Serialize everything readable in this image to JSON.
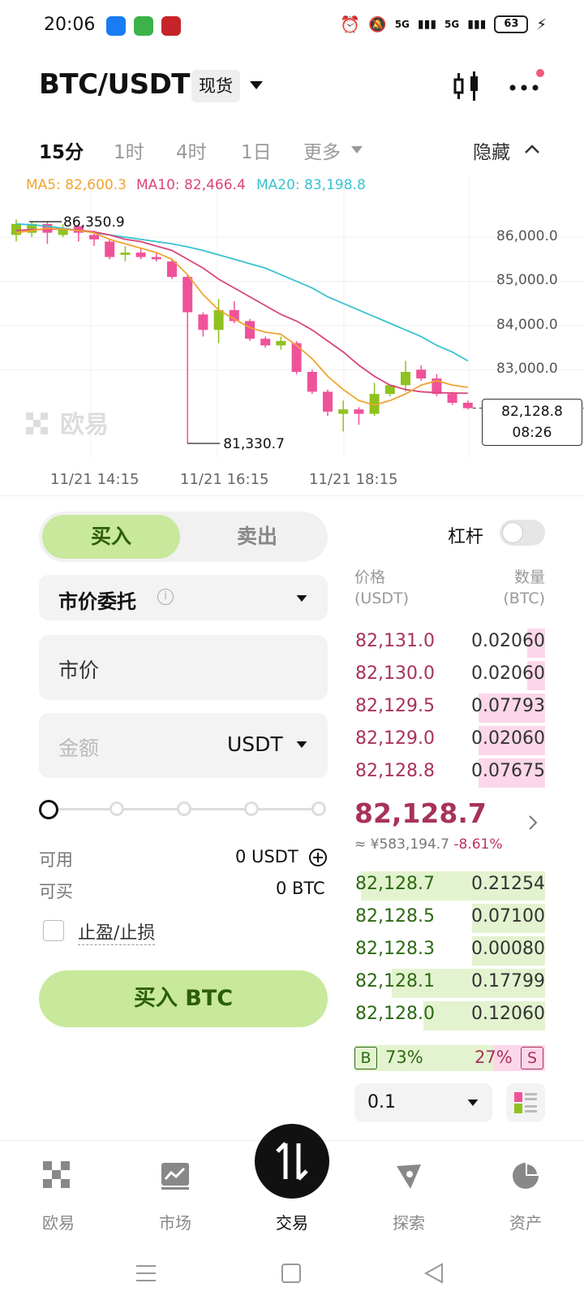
{
  "status_bar": {
    "time": "20:06",
    "battery": "63",
    "network": "5G"
  },
  "header": {
    "pair": "BTC/USDT",
    "market_tag": "现货"
  },
  "timeframes": {
    "items": [
      "15分",
      "1时",
      "4时",
      "1日",
      "更多"
    ],
    "active": "15分",
    "hide_label": "隐藏"
  },
  "chart": {
    "ma5_label": "MA5: 82,600.3",
    "ma10_label": "MA10: 82,466.4",
    "ma20_label": "MA20: 83,198.8",
    "colors": {
      "ma5": "#f0a430",
      "ma10": "#d9457a",
      "ma20": "#38c2d0",
      "up": "#8fc21e",
      "down": "#f0529a"
    },
    "watermark": "欧易",
    "high_label": "86,350.9",
    "low_label": "81,330.7",
    "last_price": "82,128.8",
    "countdown": "08:26",
    "y_ticks": [
      "86,000.0",
      "85,000.0",
      "84,000.0",
      "83,000.0"
    ],
    "x_ticks": [
      "11/21 14:15",
      "11/21 16:15",
      "11/21 18:15"
    ]
  },
  "chart_data": {
    "type": "candlestick",
    "ylim": [
      81000,
      86700
    ],
    "candles": [
      {
        "o": 86050,
        "h": 86400,
        "c": 86300,
        "l": 85900
      },
      {
        "o": 86100,
        "h": 86350,
        "c": 86300,
        "l": 86000
      },
      {
        "o": 86300,
        "h": 86350,
        "c": 86100,
        "l": 85850
      },
      {
        "o": 86050,
        "h": 86300,
        "c": 86200,
        "l": 86000
      },
      {
        "o": 86250,
        "h": 86300,
        "c": 86100,
        "l": 85900
      },
      {
        "o": 86050,
        "h": 86150,
        "c": 85950,
        "l": 85800
      },
      {
        "o": 85900,
        "h": 85950,
        "c": 85550,
        "l": 85500
      },
      {
        "o": 85600,
        "h": 85800,
        "c": 85650,
        "l": 85450
      },
      {
        "o": 85650,
        "h": 85750,
        "c": 85550,
        "l": 85500
      },
      {
        "o": 85550,
        "h": 85650,
        "c": 85500,
        "l": 85450
      },
      {
        "o": 85450,
        "h": 85500,
        "c": 85100,
        "l": 85050
      },
      {
        "o": 85100,
        "h": 85150,
        "c": 84300,
        "l": 81330
      },
      {
        "o": 84250,
        "h": 84300,
        "c": 83900,
        "l": 83750
      },
      {
        "o": 83900,
        "h": 84600,
        "c": 84350,
        "l": 83600
      },
      {
        "o": 84350,
        "h": 84550,
        "c": 84100,
        "l": 84050
      },
      {
        "o": 84100,
        "h": 84150,
        "c": 83700,
        "l": 83650
      },
      {
        "o": 83700,
        "h": 83750,
        "c": 83550,
        "l": 83500
      },
      {
        "o": 83550,
        "h": 83750,
        "c": 83650,
        "l": 83450
      },
      {
        "o": 83600,
        "h": 83650,
        "c": 82950,
        "l": 82900
      },
      {
        "o": 82950,
        "h": 83000,
        "c": 82500,
        "l": 82450
      },
      {
        "o": 82500,
        "h": 82550,
        "c": 82050,
        "l": 81950
      },
      {
        "o": 82000,
        "h": 82300,
        "c": 82100,
        "l": 81600
      },
      {
        "o": 82100,
        "h": 82150,
        "c": 82000,
        "l": 81750
      },
      {
        "o": 82000,
        "h": 82700,
        "c": 82450,
        "l": 81950
      },
      {
        "o": 82450,
        "h": 82600,
        "c": 82650,
        "l": 82400
      },
      {
        "o": 82650,
        "h": 83200,
        "c": 82950,
        "l": 82500
      },
      {
        "o": 83000,
        "h": 83100,
        "c": 82800,
        "l": 82750
      },
      {
        "o": 82800,
        "h": 82900,
        "c": 82450,
        "l": 82400
      },
      {
        "o": 82450,
        "h": 82500,
        "c": 82250,
        "l": 82200
      },
      {
        "o": 82250,
        "h": 82300,
        "c": 82128,
        "l": 82100
      }
    ],
    "ma5": [
      86100,
      86150,
      86200,
      86180,
      86150,
      86100,
      85950,
      85850,
      85750,
      85650,
      85500,
      85150,
      84700,
      84350,
      84150,
      83950,
      83850,
      83800,
      83550,
      83250,
      82850,
      82550,
      82300,
      82200,
      82300,
      82450,
      82650,
      82750,
      82650,
      82600
    ],
    "ma10": [
      86150,
      86170,
      86180,
      86180,
      86160,
      86120,
      86050,
      85950,
      85900,
      85800,
      85700,
      85500,
      85300,
      85050,
      84850,
      84650,
      84450,
      84250,
      84100,
      83900,
      83650,
      83400,
      83100,
      82850,
      82650,
      82550,
      82500,
      82480,
      82470,
      82466
    ],
    "ma20": [
      86300,
      86280,
      86250,
      86200,
      86150,
      86100,
      86050,
      86000,
      85950,
      85900,
      85850,
      85780,
      85700,
      85600,
      85500,
      85400,
      85300,
      85150,
      85000,
      84850,
      84650,
      84500,
      84350,
      84200,
      84050,
      83900,
      83750,
      83550,
      83400,
      83199
    ]
  },
  "trade": {
    "buy_tab": "买入",
    "sell_tab": "卖出",
    "leverage_label": "杠杆",
    "order_type": "市价委托",
    "price_field": "市价",
    "amount_placeholder": "金额",
    "amount_unit": "USDT",
    "available_label": "可用",
    "available_value": "0 USDT",
    "can_buy_label": "可买",
    "can_buy_value": "0 BTC",
    "tpsl_label": "止盈/止损",
    "submit": "买入 BTC"
  },
  "orderbook": {
    "price_header": "价格",
    "price_unit": "(USDT)",
    "qty_header": "数量",
    "qty_unit": "(BTC)",
    "asks": [
      {
        "price": "82,131.0",
        "qty": "0.02060",
        "depth": 0.09
      },
      {
        "price": "82,130.0",
        "qty": "0.02060",
        "depth": 0.09
      },
      {
        "price": "82,129.5",
        "qty": "0.07793",
        "depth": 0.34
      },
      {
        "price": "82,129.0",
        "qty": "0.02060",
        "depth": 0.34
      },
      {
        "price": "82,128.8",
        "qty": "0.07675",
        "depth": 0.34
      }
    ],
    "mid_price": "82,128.7",
    "mid_cny": "≈ ¥583,194.7",
    "mid_change": "-8.61%",
    "bids": [
      {
        "price": "82,128.7",
        "qty": "0.21254",
        "depth": 0.94
      },
      {
        "price": "82,128.5",
        "qty": "0.07100",
        "depth": 0.37
      },
      {
        "price": "82,128.3",
        "qty": "0.00080",
        "depth": 0.37
      },
      {
        "price": "82,128.1",
        "qty": "0.17799",
        "depth": 0.78
      },
      {
        "price": "82,128.0",
        "qty": "0.12060",
        "depth": 0.62
      }
    ],
    "buy_ratio_tag": "B",
    "buy_ratio": "73%",
    "sell_ratio": "27%",
    "sell_ratio_tag": "S",
    "buy_ratio_value": 0.73,
    "precision": "0.1"
  },
  "bottom_nav": {
    "items": [
      {
        "label": "欧易",
        "icon": "okx-logo-icon"
      },
      {
        "label": "市场",
        "icon": "market-chart-icon"
      },
      {
        "label": "交易",
        "icon": "trade-swap-icon"
      },
      {
        "label": "探索",
        "icon": "explore-icon"
      },
      {
        "label": "资产",
        "icon": "assets-pie-icon"
      }
    ],
    "active": "交易"
  }
}
